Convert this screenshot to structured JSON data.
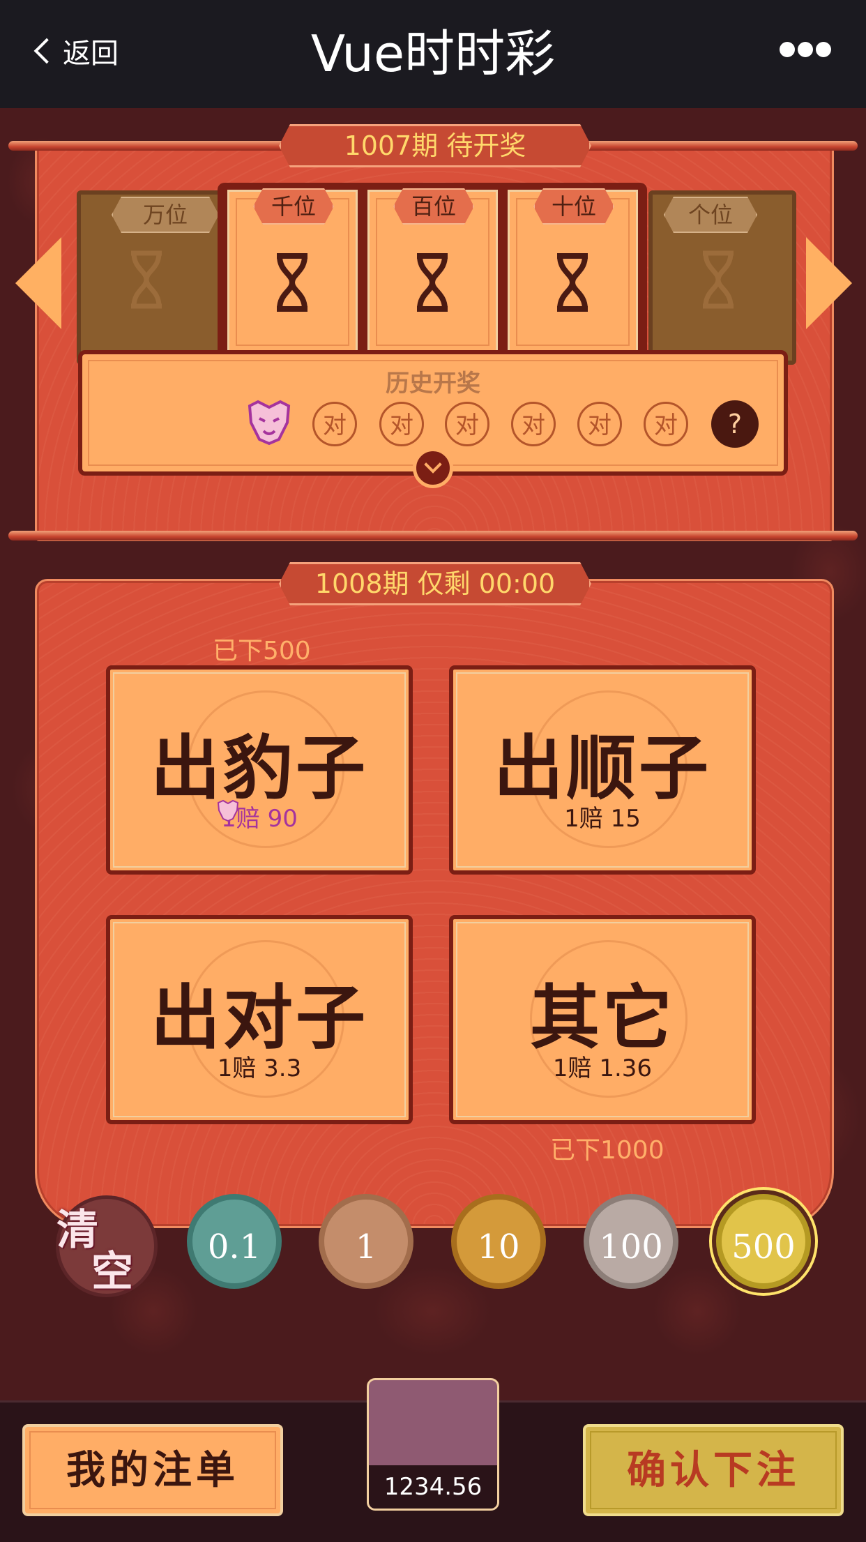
{
  "nav": {
    "back_label": "返回",
    "title": "Vue时时彩"
  },
  "current_draw": {
    "banner": "1007期 待开奖"
  },
  "positions": {
    "wan": "万位",
    "qian": "千位",
    "bai": "百位",
    "shi": "十位",
    "ge": "个位"
  },
  "history": {
    "label": "历史开奖",
    "results": [
      "对",
      "对",
      "对",
      "对",
      "对",
      "对"
    ],
    "pending": "?"
  },
  "next_draw": {
    "banner": "1008期 仅剩 00:00"
  },
  "bets": {
    "baozi": {
      "name": "出豹子",
      "odds": "1赔 90",
      "placed": "已下500"
    },
    "shunzi": {
      "name": "出顺子",
      "odds": "1赔 15"
    },
    "duizi": {
      "name": "出对子",
      "odds": "1赔 3.3"
    },
    "other": {
      "name": "其它",
      "odds": "1赔 1.36",
      "placed": "已下1000"
    }
  },
  "chips": {
    "clear_top": "清",
    "clear_bottom": "空",
    "values": [
      "0.1",
      "1",
      "10",
      "100",
      "500"
    ],
    "selected": "500"
  },
  "footer": {
    "my_bets": "我的注单",
    "balance": "1234.56",
    "confirm": "确认下注"
  },
  "colors": {
    "panel_red": "#d9503a",
    "card_orange": "#ffad66",
    "dark_brown": "#7b1e14",
    "gold_text": "#ffd86b"
  }
}
